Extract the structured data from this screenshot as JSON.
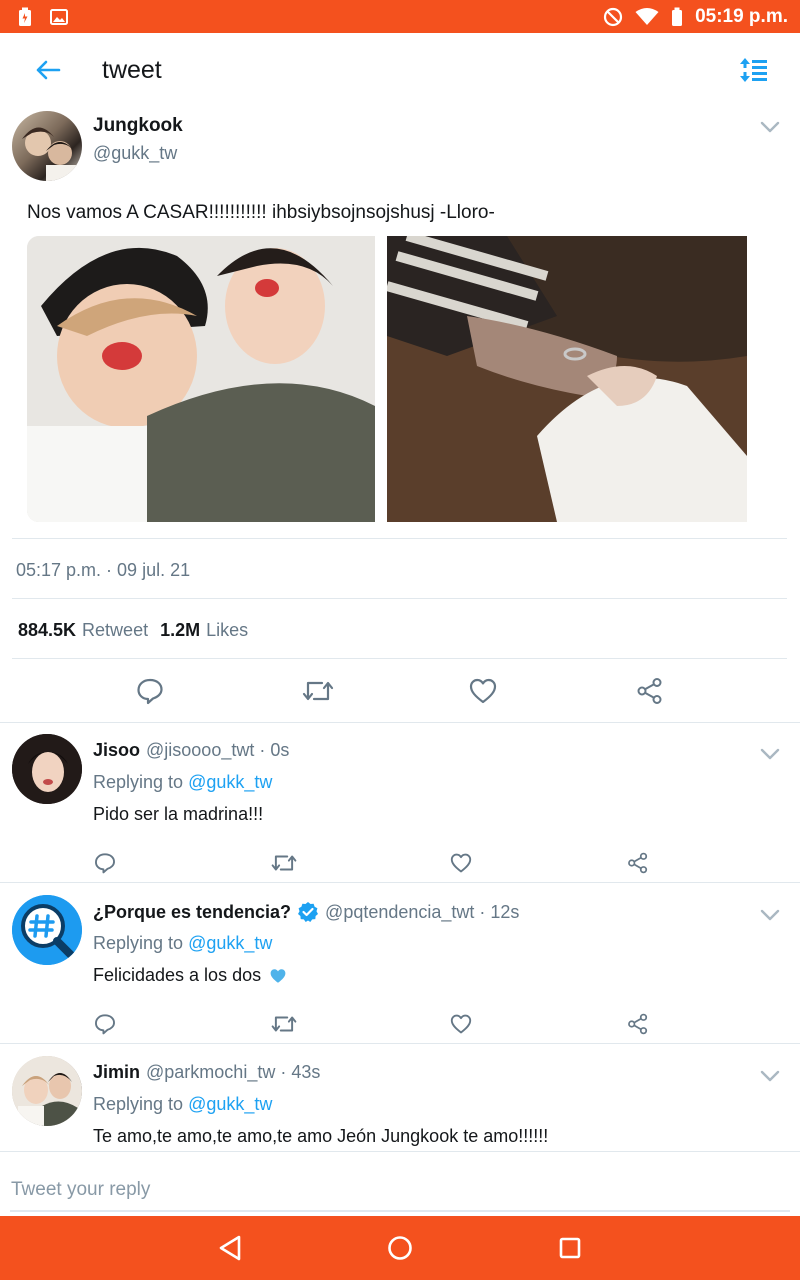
{
  "status_bar": {
    "time": "05:19 p.m.",
    "icons": [
      "battery-charging-icon",
      "image-notification-icon",
      "do-not-disturb-icon",
      "wifi-icon",
      "battery-icon"
    ]
  },
  "header": {
    "title": "tweet",
    "icons": [
      "back-arrow-icon",
      "sort-icon"
    ]
  },
  "main_tweet": {
    "author_name": "Jungkook",
    "author_handle": "@gukk_tw",
    "text": "Nos vamos A CASAR!!!!!!!!!!! ihbsiybsojnsojshusj -Lloro-",
    "timestamp": "05:17 p.m. · 09 jul. 21",
    "retweet_count": "884.5K",
    "retweet_label": "Retweet",
    "like_count": "1.2M",
    "like_label": "Likes",
    "action_icons": [
      "reply-icon",
      "retweet-icon",
      "heart-icon",
      "share-icon"
    ]
  },
  "replies": [
    {
      "name": "Jisoo",
      "meta": "@jisoooo_twt · 0s",
      "replying_prefix": "Replying to",
      "replying_to": "@gukk_tw",
      "text": "Pido ser la madrina!!!"
    },
    {
      "name": "¿Porque es tendencia?",
      "meta": "@pqtendencia_twt · 12s",
      "replying_prefix": "Replying to",
      "replying_to": "@gukk_tw",
      "text": "Felicidades a los dos"
    },
    {
      "name": "Jimin",
      "meta": "@parkmochi_tw · 43s",
      "replying_prefix": "Replying to",
      "replying_to": "@gukk_tw",
      "text": "Te amo,te amo,te amo,te amo Jeón Jungkook te amo!!!!!!"
    }
  ],
  "composer": {
    "placeholder": "Tweet your reply"
  },
  "colors": {
    "status_bar": "#f4511e",
    "accent_blue": "#1da1f2",
    "muted_text": "#657786"
  }
}
